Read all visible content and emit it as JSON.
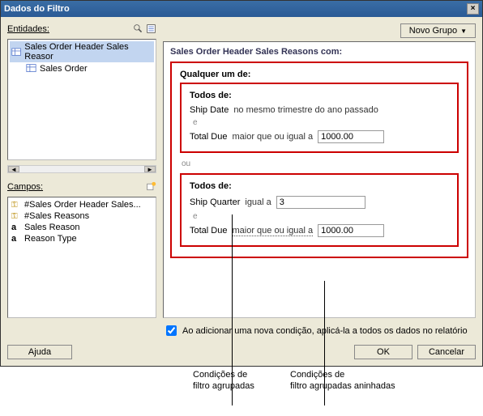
{
  "window": {
    "title": "Dados do Filtro"
  },
  "entities": {
    "label": "Entidades:",
    "items": [
      {
        "label": "Sales Order Header Sales Reasor"
      },
      {
        "label": "Sales Order"
      }
    ]
  },
  "fields": {
    "label": "Campos:",
    "items": [
      {
        "kind": "key",
        "label": "#Sales Order Header Sales..."
      },
      {
        "kind": "key",
        "label": "#Sales Reasons"
      },
      {
        "kind": "text",
        "label": "Sales Reason"
      },
      {
        "kind": "text",
        "label": "Reason Type"
      }
    ]
  },
  "buttons": {
    "newgroup": "Novo Grupo",
    "help": "Ajuda",
    "ok": "OK",
    "cancel": "Cancelar"
  },
  "panel": {
    "header": "Sales Order Header Sales Reasons com:",
    "group_any": "Qualquer um de:",
    "group_all": "Todos de:",
    "conn_and": "e",
    "conn_or": "ou",
    "cond1_field": "Ship Date",
    "cond1_op": "no mesmo trimestre do ano passado",
    "cond2_field": "Total Due",
    "cond2_op": "maior que ou igual a",
    "cond2_value": "1000.00",
    "cond3_field": "Ship Quarter",
    "cond3_op": "igual a",
    "cond3_value": "3",
    "cond4_field": "Total Due",
    "cond4_op": "maior que ou igual a",
    "cond4_value": "1000.00"
  },
  "checkbox": {
    "label": "Ao adicionar uma nova condição, aplicá-la a todos os dados no relatório",
    "checked": true
  },
  "annotations": {
    "left": "Condições de\nfiltro agrupadas",
    "right": "Condições de\nfiltro agrupadas aninhadas"
  }
}
